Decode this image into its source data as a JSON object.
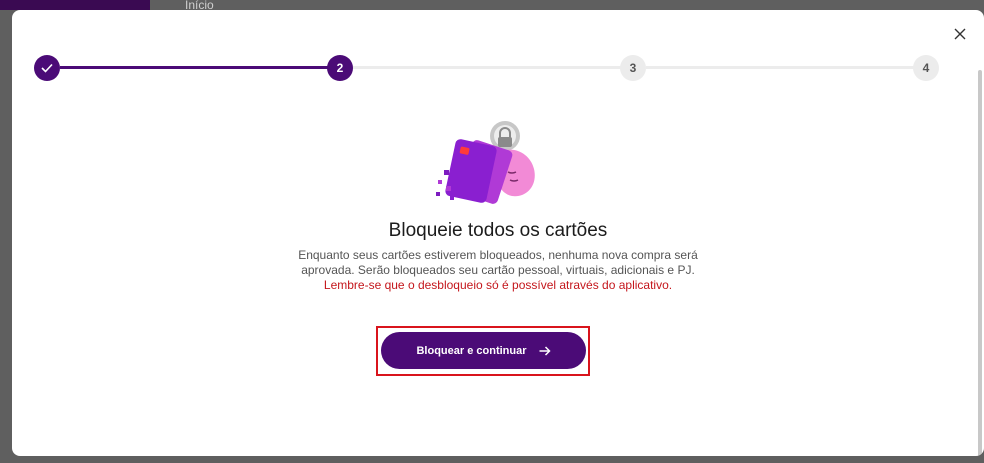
{
  "background": {
    "header_text": "Início"
  },
  "stepper": {
    "steps": [
      {
        "label": "",
        "state": "done"
      },
      {
        "label": "2",
        "state": "active"
      },
      {
        "label": "3",
        "state": "todo"
      },
      {
        "label": "4",
        "state": "todo"
      }
    ]
  },
  "icons": {
    "close": "close-icon",
    "check": "check-icon",
    "arrow": "arrow-right-icon",
    "illustration": "cards-lock-icon"
  },
  "content": {
    "title": "Bloqueie todos os cartões",
    "description_line1": "Enquanto seus cartões estiverem bloqueados, nenhuma nova compra será",
    "description_line2": "aprovada. Serão bloqueados seu cartão pessoal, virtuais, adicionais e PJ.",
    "warning": "Lembre-se que o desbloqueio só é possível através do aplicativo."
  },
  "cta": {
    "label": "Bloquear e continuar"
  },
  "colors": {
    "primary": "#4b0b77",
    "warning": "#c4161c",
    "highlight_frame": "#d9141c",
    "step_todo": "#ececec"
  }
}
